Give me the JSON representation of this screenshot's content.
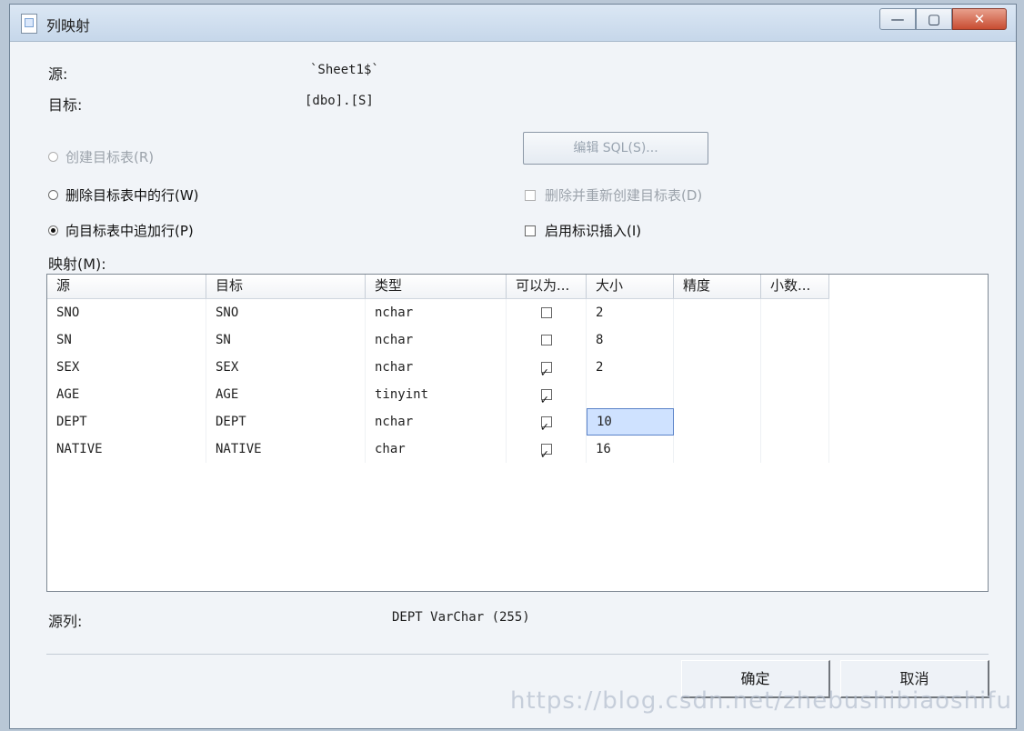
{
  "window": {
    "title": "列映射",
    "controls": {
      "minimize_icon": "minimize-icon",
      "maximize_icon": "maximize-icon",
      "close_icon": "close-icon"
    }
  },
  "form": {
    "source_label": "源:",
    "source_value": "`Sheet1$`",
    "target_label": "目标:",
    "target_value": "[dbo].[S]",
    "options": {
      "create_table": "创建目标表(R)",
      "delete_rows": "删除目标表中的行(W)",
      "append_rows": "向目标表中追加行(P)"
    },
    "edit_sql_button": "编辑 SQL(S)...",
    "drop_recreate": "删除并重新创建目标表(D)",
    "enable_identity_insert": "启用标识插入(I)",
    "mapping_label": "映射(M):"
  },
  "grid": {
    "headers": [
      "源",
      "目标",
      "类型",
      "可以为...",
      "大小",
      "精度",
      "小数..."
    ],
    "rows": [
      {
        "source": "SNO",
        "target": "SNO",
        "type": "nchar",
        "nullable": false,
        "size": "2",
        "precision": "",
        "scale": ""
      },
      {
        "source": "SN",
        "target": "SN",
        "type": "nchar",
        "nullable": false,
        "size": "8",
        "precision": "",
        "scale": ""
      },
      {
        "source": "SEX",
        "target": "SEX",
        "type": "nchar",
        "nullable": true,
        "size": "2",
        "precision": "",
        "scale": ""
      },
      {
        "source": "AGE",
        "target": "AGE",
        "type": "tinyint",
        "nullable": true,
        "size": "",
        "precision": "",
        "scale": ""
      },
      {
        "source": "DEPT",
        "target": "DEPT",
        "type": "nchar",
        "nullable": true,
        "size": "10",
        "precision": "",
        "scale": ""
      },
      {
        "source": "NATIVE",
        "target": "NATIVE",
        "type": "char",
        "nullable": true,
        "size": "16",
        "precision": "",
        "scale": ""
      }
    ]
  },
  "footer": {
    "source_column_label": "源列:",
    "source_column_value": "DEPT VarChar (255)",
    "ok_button": "确定",
    "cancel_button": "取消",
    "watermark": "https://blog.csdn.net/zhebushibiaoshifu"
  }
}
